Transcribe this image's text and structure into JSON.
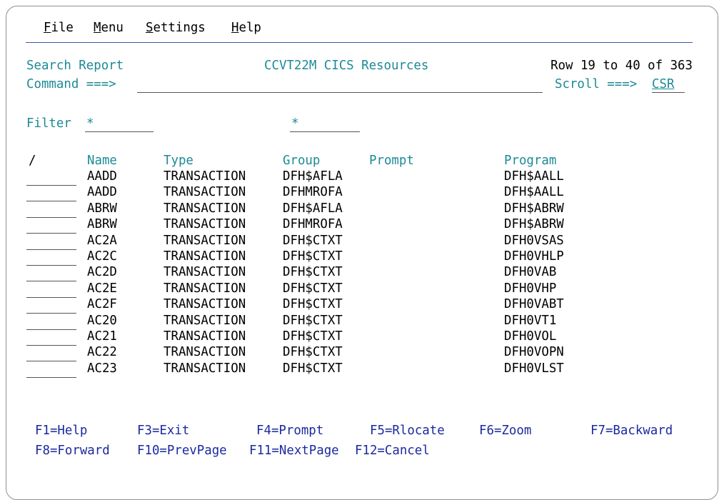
{
  "menu": {
    "items": [
      {
        "label": "File",
        "hotkey": "F",
        "rest": "ile"
      },
      {
        "label": "Menu",
        "hotkey": "M",
        "rest": "enu"
      },
      {
        "label": "Settings",
        "hotkey": "S",
        "rest": "ettings"
      },
      {
        "label": "Help",
        "hotkey": "H",
        "rest": "elp"
      }
    ]
  },
  "header": {
    "panel_title": "Search Report",
    "center_title": "CCVT22M CICS Resources",
    "row_info": "Row 19 to 40 of 363",
    "command_label": "Command ===>",
    "command_value": "",
    "scroll_label": "Scroll ===>",
    "scroll_value": "CSR"
  },
  "filter": {
    "label": "Filter",
    "name_value": "*",
    "group_value": "*"
  },
  "table": {
    "columns": {
      "select": "/",
      "name": "Name",
      "type": "Type",
      "group": "Group",
      "prompt": "Prompt",
      "program": "Program"
    },
    "rows": [
      {
        "name": "AADD",
        "type": "TRANSACTION",
        "group": "DFH$AFLA",
        "prompt": "",
        "program": "DFH$AALL"
      },
      {
        "name": "AADD",
        "type": "TRANSACTION",
        "group": "DFHMROFA",
        "prompt": "",
        "program": "DFH$AALL"
      },
      {
        "name": "ABRW",
        "type": "TRANSACTION",
        "group": "DFH$AFLA",
        "prompt": "",
        "program": "DFH$ABRW"
      },
      {
        "name": "ABRW",
        "type": "TRANSACTION",
        "group": "DFHMROFA",
        "prompt": "",
        "program": "DFH$ABRW"
      },
      {
        "name": "AC2A",
        "type": "TRANSACTION",
        "group": "DFH$CTXT",
        "prompt": "",
        "program": "DFH0VSAS"
      },
      {
        "name": "AC2C",
        "type": "TRANSACTION",
        "group": "DFH$CTXT",
        "prompt": "",
        "program": "DFH0VHLP"
      },
      {
        "name": "AC2D",
        "type": "TRANSACTION",
        "group": "DFH$CTXT",
        "prompt": "",
        "program": "DFH0VAB"
      },
      {
        "name": "AC2E",
        "type": "TRANSACTION",
        "group": "DFH$CTXT",
        "prompt": "",
        "program": "DFH0VHP"
      },
      {
        "name": "AC2F",
        "type": "TRANSACTION",
        "group": "DFH$CTXT",
        "prompt": "",
        "program": "DFH0VABT"
      },
      {
        "name": "AC20",
        "type": "TRANSACTION",
        "group": "DFH$CTXT",
        "prompt": "",
        "program": "DFH0VT1"
      },
      {
        "name": "AC21",
        "type": "TRANSACTION",
        "group": "DFH$CTXT",
        "prompt": "",
        "program": "DFH0VOL"
      },
      {
        "name": "AC22",
        "type": "TRANSACTION",
        "group": "DFH$CTXT",
        "prompt": "",
        "program": "DFH0VOPN"
      },
      {
        "name": "AC23",
        "type": "TRANSACTION",
        "group": "DFH$CTXT",
        "prompt": "",
        "program": "DFH0VLST"
      }
    ]
  },
  "function_keys": {
    "row1": [
      "F1=Help",
      "F3=Exit",
      "F4=Prompt",
      "F5=Rlocate",
      "F6=Zoom",
      "F7=Backward"
    ],
    "row2": [
      "F8=Forward",
      "F10=PrevPage",
      "F11=NextPage",
      "F12=Cancel"
    ]
  },
  "colors": {
    "label_teal": "#1c8a96",
    "fkey_blue": "#1a2a9e",
    "separator": "#3b5aa8"
  }
}
